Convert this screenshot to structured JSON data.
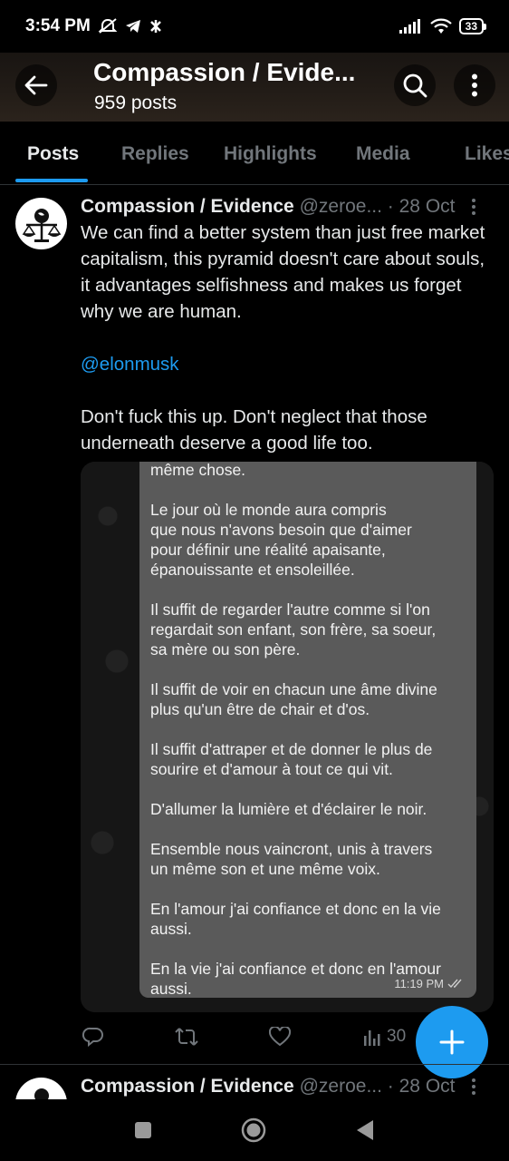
{
  "status_bar": {
    "time": "3:54 PM",
    "battery": "33"
  },
  "header": {
    "title": "Compassion / Evide...",
    "post_count": "959 posts"
  },
  "tabs": [
    {
      "label": "Posts"
    },
    {
      "label": "Replies"
    },
    {
      "label": "Highlights"
    },
    {
      "label": "Media"
    },
    {
      "label": "Likes"
    }
  ],
  "tweets": [
    {
      "name": "Compassion / Evidence",
      "handle": "@zeroe...",
      "date": "· 28 Oct",
      "text_1": "We can find a better system than just free market capitalism, this pyramid doesn't care about souls, it advantages selfishness and makes us forget why we are human.",
      "mention": "@elonmusk",
      "text_2": "Don't fuck this up. Don't neglect that those underneath deserve a good life too.",
      "image": {
        "text": "même chose.\n\nLe jour où le monde aura compris\nque nous n'avons besoin que d'aimer\npour définir une réalité apaisante,\népanouissante et ensoleillée.\n\nIl suffit de regarder l'autre comme si l'on\nregardait son enfant, son frère, sa soeur,\nsa mère ou son père.\n\nIl suffit de voir en chacun une âme divine\nplus qu'un être de chair et d'os.\n\nIl suffit d'attraper et de donner le plus de\nsourire et d'amour à tout ce qui vit.\n\nD'allumer la lumière et d'éclairer le noir.\n\nEnsemble nous vaincront, unis à travers\nun même son et une même voix.\n\nEn l'amour j'ai confiance et donc en la vie\naussi.\n\nEn la vie j'ai confiance et donc en l'amour\naussi.",
        "time": "11:19 PM"
      },
      "views": "30"
    },
    {
      "name": "Compassion / Evidence",
      "handle": "@zeroe...",
      "date": "· 28 Oct"
    }
  ],
  "colors": {
    "accent": "#1d9bf0",
    "background": "#000000",
    "secondary_text": "#71767b"
  }
}
